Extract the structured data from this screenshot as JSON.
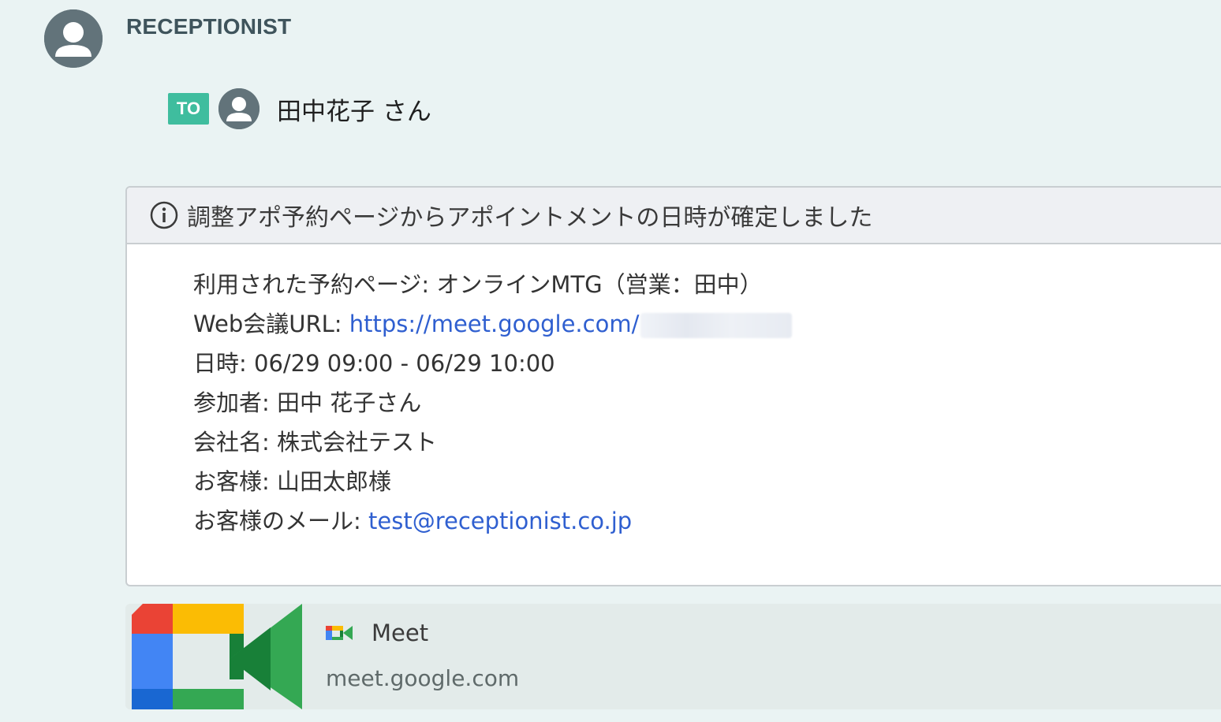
{
  "sender": {
    "avatar_icon": "user-avatar-icon",
    "name": "RECEPTIONIST"
  },
  "to": {
    "badge": "TO",
    "avatar_icon": "user-avatar-icon",
    "name": "田中花子 さん"
  },
  "notice": {
    "icon": "info-icon",
    "title": "調整アポ予約ページからアポイントメントの日時が確定しました",
    "lines": {
      "page_label": "利用された予約ページ: ",
      "page_value": "オンラインMTG（営業：田中）",
      "url_label": "Web会議URL: ",
      "url_value": "https://meet.google.com/",
      "datetime_label": "日時: ",
      "datetime_value": "06/29 09:00 - 06/29 10:00",
      "participants_label": "参加者: ",
      "participants_value": "田中 花子さん",
      "company_label": "会社名: ",
      "company_value": "株式会社テスト",
      "customer_label": "お客様: ",
      "customer_value": "山田太郎様",
      "email_label": "お客様のメール: ",
      "email_value": "test@receptionist.co.jp"
    }
  },
  "link_preview": {
    "logo_icon": "google-meet-icon",
    "title": "Meet",
    "domain": "meet.google.com"
  },
  "colors": {
    "background": "#eaf3f3",
    "to_badge": "#3fbd9e",
    "link": "#2f5fd0",
    "header_bg": "#eef0f3"
  }
}
